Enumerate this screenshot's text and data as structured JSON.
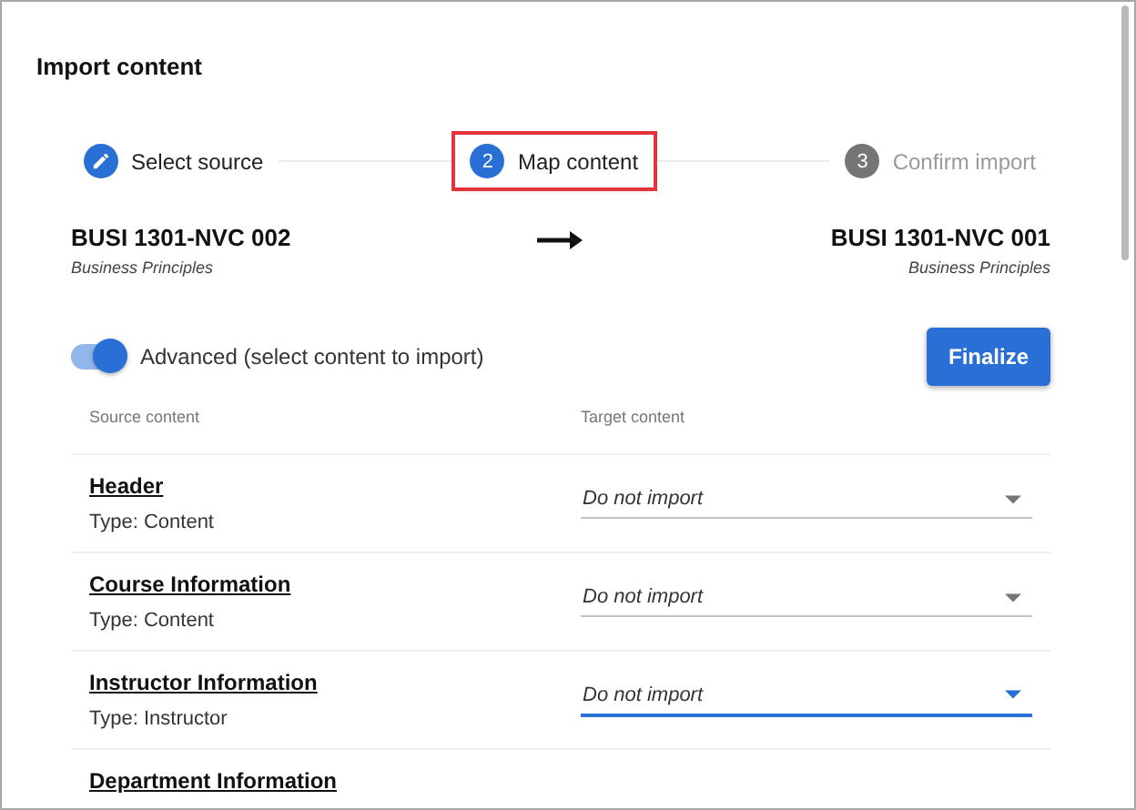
{
  "dialog": {
    "title": "Import content"
  },
  "steps": [
    {
      "label": "Select source",
      "selected": false,
      "completed": true
    },
    {
      "number": "2",
      "label": "Map content",
      "selected": true,
      "completed": false
    },
    {
      "number": "3",
      "label": "Confirm import",
      "selected": false,
      "completed": false
    }
  ],
  "source": {
    "code": "BUSI 1301-NVC 002",
    "name": "Business Principles"
  },
  "target": {
    "code": "BUSI 1301-NVC 001",
    "name": "Business Principles"
  },
  "advanced_toggle": {
    "label": "Advanced (select content to import)",
    "on": true
  },
  "finalize_button": "Finalize",
  "table": {
    "columns": [
      "Source content",
      "Target content"
    ],
    "rows": [
      {
        "name": "Header",
        "type": "Type: Content",
        "target": "Do not import",
        "focused": false
      },
      {
        "name": "Course Information",
        "type": "Type: Content",
        "target": "Do not import",
        "focused": false
      },
      {
        "name": "Instructor Information",
        "type": "Type: Instructor",
        "target": "Do not import",
        "focused": true
      },
      {
        "name": "Department Information"
      }
    ]
  }
}
